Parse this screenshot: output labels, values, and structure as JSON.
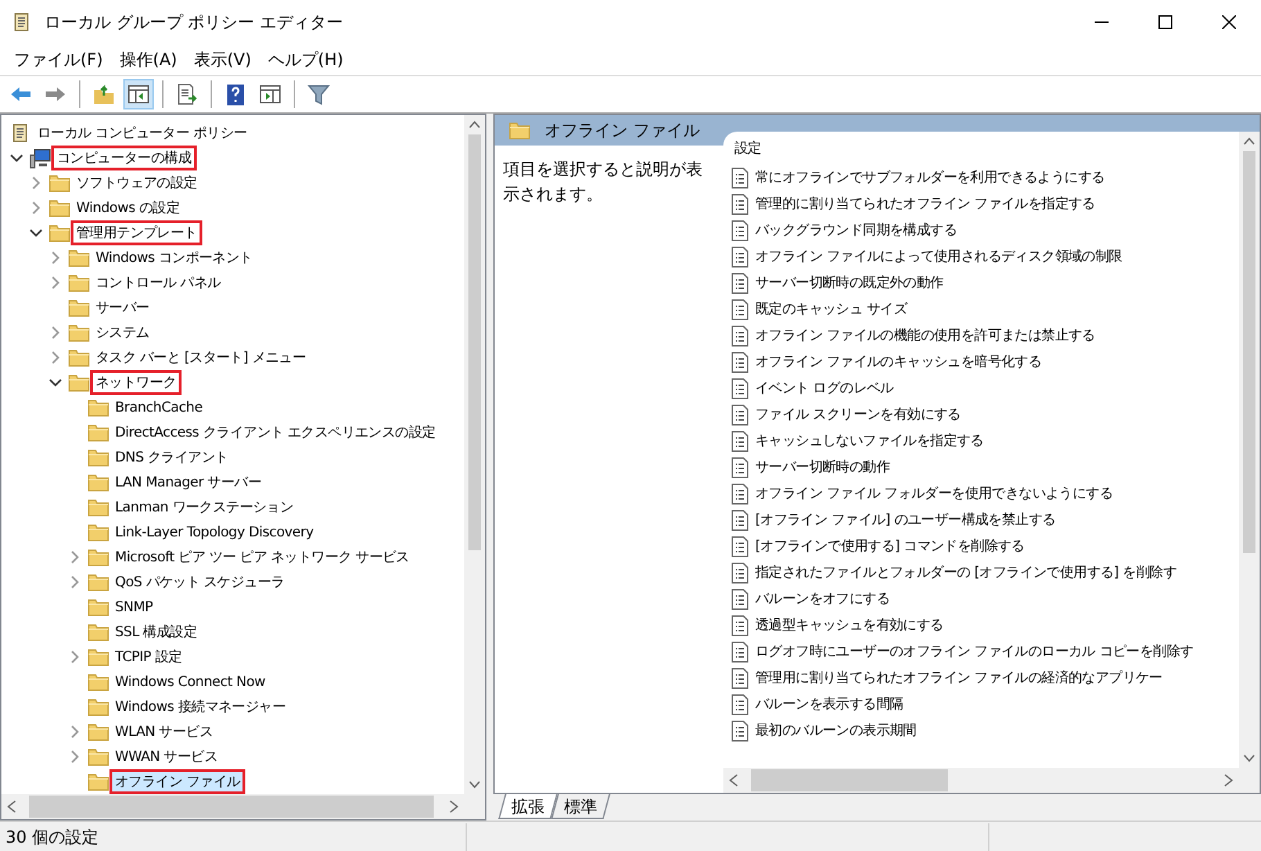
{
  "window": {
    "title": "ローカル グループ ポリシー エディター"
  },
  "menu": [
    "ファイル(F)",
    "操作(A)",
    "表示(V)",
    "ヘルプ(H)"
  ],
  "toolbar": [
    {
      "kind": "back",
      "pressed": false
    },
    {
      "kind": "forward",
      "pressed": false
    },
    {
      "kind": "sep"
    },
    {
      "kind": "up",
      "pressed": false
    },
    {
      "kind": "tree",
      "pressed": true
    },
    {
      "kind": "sep"
    },
    {
      "kind": "export",
      "pressed": false
    },
    {
      "kind": "sep"
    },
    {
      "kind": "help",
      "pressed": false
    },
    {
      "kind": "pane",
      "pressed": false
    },
    {
      "kind": "sep"
    },
    {
      "kind": "filter",
      "pressed": false
    }
  ],
  "tree": [
    {
      "label": "ローカル コンピューター ポリシー",
      "kind": "scroll",
      "selected": false,
      "marked": false,
      "children": [
        {
          "label": "コンピューターの構成",
          "kind": "computer",
          "expanded": true,
          "selected": false,
          "marked": true,
          "children": [
            {
              "label": "ソフトウェアの設定",
              "kind": "folder",
              "expanded": false,
              "selected": false,
              "marked": false
            },
            {
              "label": "Windows の設定",
              "kind": "folder",
              "expanded": false,
              "selected": false,
              "marked": false
            },
            {
              "label": "管理用テンプレート",
              "kind": "folder",
              "expanded": true,
              "selected": false,
              "marked": true,
              "children": [
                {
                  "label": "Windows コンポーネント",
                  "kind": "folder",
                  "expanded": false,
                  "selected": false,
                  "marked": false
                },
                {
                  "label": "コントロール パネル",
                  "kind": "folder",
                  "expanded": false,
                  "selected": false,
                  "marked": false
                },
                {
                  "label": "サーバー",
                  "kind": "folder",
                  "selected": false,
                  "marked": false
                },
                {
                  "label": "システム",
                  "kind": "folder",
                  "expanded": false,
                  "selected": false,
                  "marked": false
                },
                {
                  "label": "タスク バーと [スタート] メニュー",
                  "kind": "folder",
                  "expanded": false,
                  "selected": false,
                  "marked": false
                },
                {
                  "label": "ネットワーク",
                  "kind": "folder",
                  "expanded": true,
                  "selected": false,
                  "marked": true,
                  "children": [
                    {
                      "label": "BranchCache",
                      "kind": "folder",
                      "selected": false,
                      "marked": false
                    },
                    {
                      "label": "DirectAccess クライアント エクスペリエンスの設定",
                      "kind": "folder",
                      "selected": false,
                      "marked": false
                    },
                    {
                      "label": "DNS クライアント",
                      "kind": "folder",
                      "selected": false,
                      "marked": false
                    },
                    {
                      "label": "LAN Manager サーバー",
                      "kind": "folder",
                      "selected": false,
                      "marked": false
                    },
                    {
                      "label": "Lanman ワークステーション",
                      "kind": "folder",
                      "selected": false,
                      "marked": false
                    },
                    {
                      "label": "Link-Layer Topology Discovery",
                      "kind": "folder",
                      "selected": false,
                      "marked": false
                    },
                    {
                      "label": "Microsoft ピア ツー ピア ネットワーク サービス",
                      "kind": "folder",
                      "expanded": false,
                      "selected": false,
                      "marked": false
                    },
                    {
                      "label": "QoS パケット スケジューラ",
                      "kind": "folder",
                      "expanded": false,
                      "selected": false,
                      "marked": false
                    },
                    {
                      "label": "SNMP",
                      "kind": "folder",
                      "selected": false,
                      "marked": false
                    },
                    {
                      "label": "SSL 構成設定",
                      "kind": "folder",
                      "selected": false,
                      "marked": false
                    },
                    {
                      "label": "TCPIP 設定",
                      "kind": "folder",
                      "expanded": false,
                      "selected": false,
                      "marked": false
                    },
                    {
                      "label": "Windows Connect Now",
                      "kind": "folder",
                      "selected": false,
                      "marked": false
                    },
                    {
                      "label": "Windows 接続マネージャー",
                      "kind": "folder",
                      "selected": false,
                      "marked": false
                    },
                    {
                      "label": "WLAN サービス",
                      "kind": "folder",
                      "expanded": false,
                      "selected": false,
                      "marked": false
                    },
                    {
                      "label": "WWAN サービス",
                      "kind": "folder",
                      "expanded": false,
                      "selected": false,
                      "marked": false
                    },
                    {
                      "label": "オフライン ファイル",
                      "kind": "folder",
                      "selected": true,
                      "marked": true
                    }
                  ]
                }
              ]
            }
          ]
        }
      ]
    }
  ],
  "details": {
    "header": "オフライン ファイル",
    "description": "項目を選択すると説明が表示されます。",
    "column": "設定",
    "settings": [
      "常にオフラインでサブフォルダーを利用できるようにする",
      "管理的に割り当てられたオフライン ファイルを指定する",
      "バックグラウンド同期を構成する",
      "オフライン ファイルによって使用されるディスク領域の制限",
      "サーバー切断時の既定外の動作",
      "既定のキャッシュ サイズ",
      "オフライン ファイルの機能の使用を許可または禁止する",
      "オフライン ファイルのキャッシュを暗号化する",
      "イベント ログのレベル",
      "ファイル スクリーンを有効にする",
      "キャッシュしないファイルを指定する",
      "サーバー切断時の動作",
      "オフライン ファイル フォルダーを使用できないようにする",
      "[オフライン ファイル] のユーザー構成を禁止する",
      "[オフラインで使用する] コマンドを削除する",
      "指定されたファイルとフォルダーの [オフラインで使用する] を削除す",
      "バルーンをオフにする",
      "透過型キャッシュを有効にする",
      "ログオフ時にユーザーのオフライン ファイルのローカル コピーを削除す",
      "管理用に割り当てられたオフライン ファイルの経済的なアプリケー",
      "バルーンを表示する間隔",
      "最初のバルーンの表示期間"
    ]
  },
  "tabs": [
    {
      "label": "拡張",
      "selected": true
    },
    {
      "label": "標準",
      "selected": false
    }
  ],
  "status_bar": "30 個の設定"
}
